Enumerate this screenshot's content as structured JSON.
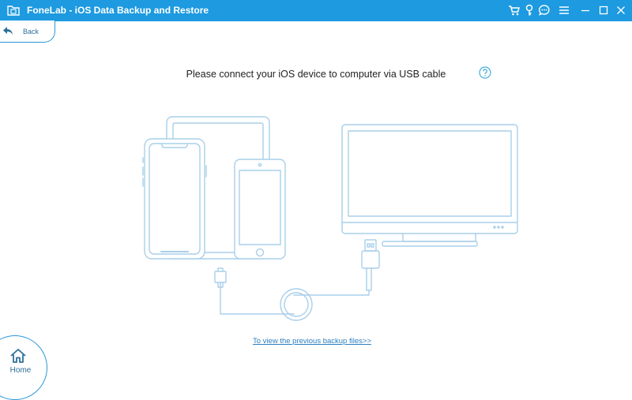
{
  "titlebar": {
    "title": "FoneLab - iOS Data Backup and Restore",
    "app_icon": "folder-icon",
    "buttons": [
      "cart-icon",
      "key-icon",
      "chat-icon",
      "menu-icon",
      "minimize-icon",
      "maximize-icon",
      "close-icon"
    ],
    "color": "#1d9ae0"
  },
  "nav": {
    "back_label": "Back",
    "back_icon": "back-arrow-icon",
    "home_label": "Home",
    "home_icon": "home-icon"
  },
  "main": {
    "prompt": "Please connect your iOS device to computer via USB cable",
    "help_icon": "question-icon",
    "illustration": "devices-connect-illustration",
    "backup_link": "To view the previous backup files>>"
  },
  "colors": {
    "accent": "#1d9ae0",
    "line_art": "#a9cfea",
    "link": "#2a7fc0"
  }
}
